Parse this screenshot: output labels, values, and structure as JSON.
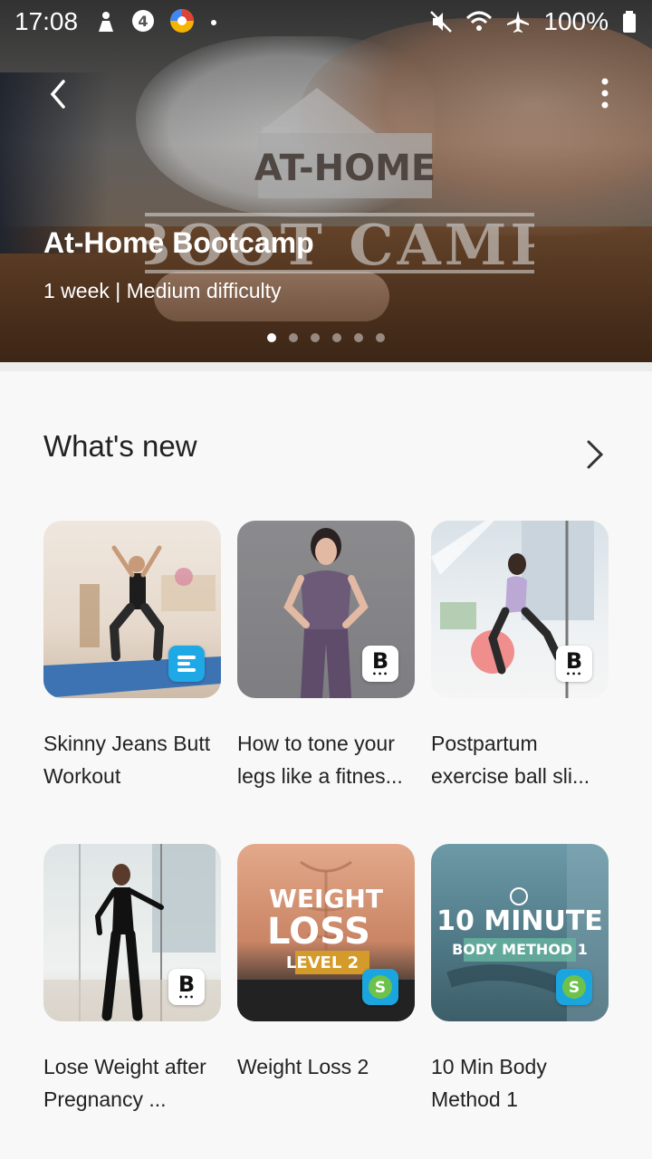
{
  "status_bar": {
    "time": "17:08",
    "battery": "100%",
    "icons": [
      "bluetooth-icon",
      "at-icon",
      "app-icon",
      "dot-icon",
      "mute-icon",
      "wifi-icon",
      "airplane-icon",
      "battery-icon"
    ]
  },
  "hero": {
    "logo_line1": "AT-HOME",
    "logo_line2": "BOOT CAMP",
    "title": "At-Home Bootcamp",
    "subtitle": "1 week | Medium difficulty",
    "page_count": 6,
    "active_page": 1
  },
  "section": {
    "title": "What's new"
  },
  "cards": [
    {
      "title": "Skinny Jeans Butt Workout",
      "badge": "e-icon"
    },
    {
      "title": "How to tone your legs like a fitnes...",
      "badge": "b-icon"
    },
    {
      "title": "Postpartum exercise ball sli...",
      "badge": "b-icon"
    },
    {
      "title": "Lose Weight after Pregnancy ...",
      "badge": "b-icon"
    },
    {
      "title": "Weight Loss 2",
      "badge": "s-icon",
      "thumb_line1": "WEIGHT",
      "thumb_line2": "LOSS",
      "thumb_line3": "LEVEL 2"
    },
    {
      "title": "10 Min Body Method 1",
      "badge": "s-icon",
      "thumb_line1": "10 MINUTE",
      "thumb_line2": "BODY METHOD 1"
    }
  ],
  "colors": {
    "background": "#f8f8f8",
    "hero_text": "#ffffff",
    "badge_blue": "#1fa8e6"
  }
}
